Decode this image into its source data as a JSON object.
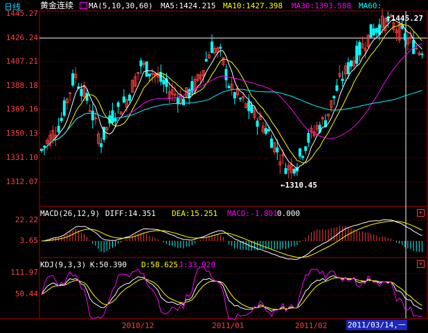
{
  "symbol": "黄金连续",
  "main_indicator": {
    "name": "MA(5,10,30,60)",
    "items": [
      {
        "label": "MA5:1424.215",
        "color": "#ffffff"
      },
      {
        "label": "MA10:1427.398",
        "color": "#ffff00"
      },
      {
        "label": "MA30:1393.588",
        "color": "#ff00ff"
      },
      {
        "label": "MA60:",
        "color": "#00ffff"
      }
    ]
  },
  "price_axis": [
    "1445.27",
    "1426.24",
    "1407.21",
    "1388.18",
    "1369.16",
    "1350.13",
    "1331.10",
    "1312.07"
  ],
  "annotations": {
    "high": "1445.27",
    "low": "1310.45"
  },
  "macd": {
    "title": "MACD(26,12,9)",
    "diff": "DIFF:14.351",
    "dea": "DEA:15.251",
    "macd": "MACD:-1.801",
    "zero": "0.000",
    "axis": [
      "22.22",
      "3.65"
    ]
  },
  "kdj": {
    "title": "KDJ(9,3,3)",
    "k": "K:50.390",
    "d": "D:58.625",
    "j": "J:33.920",
    "axis": [
      "111.97",
      "50.44"
    ]
  },
  "bottom": {
    "period_tab": "日线",
    "dates": [
      "2010/12",
      "2011/01",
      "2011/02"
    ],
    "cursor_date": "2011/03/14,一"
  },
  "colors": {
    "up": "#ff3b3b",
    "down": "#00ffff",
    "ma5": "#ffffff",
    "ma10": "#ffff00",
    "ma30": "#ff00ff",
    "ma60": "#00ffff",
    "grid": "#b00000"
  }
}
